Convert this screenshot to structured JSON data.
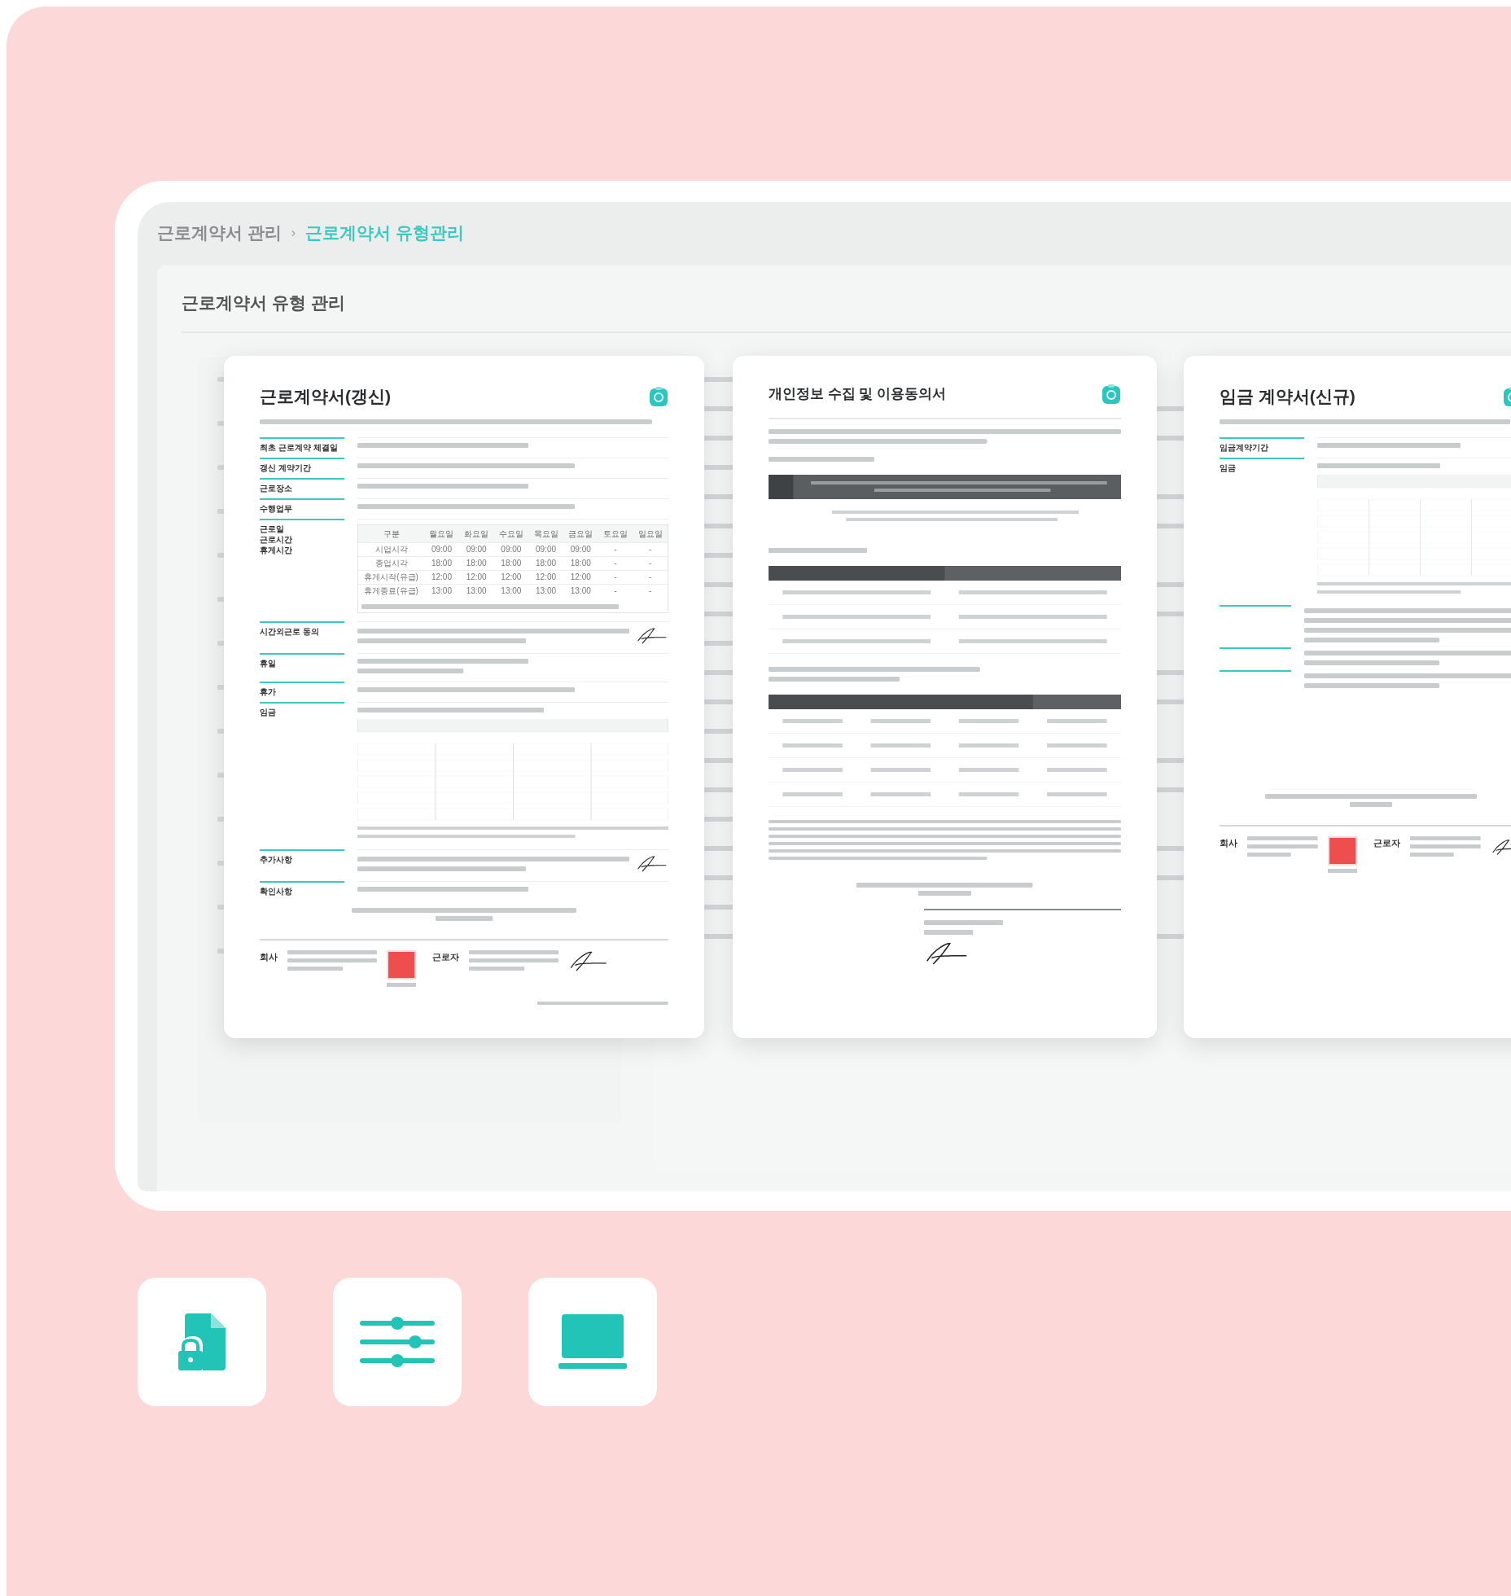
{
  "breadcrumb": {
    "separator": "›",
    "items": [
      {
        "label": "근로계약서 관리",
        "selected": false
      },
      {
        "label": "근로계약서 유형관리",
        "selected": true
      }
    ]
  },
  "page_title": "근로계약서 유형 관리",
  "documents": [
    {
      "kind": "labor",
      "title": "근로계약서(갱신)",
      "fields": [
        {
          "label": "최초 근로계약 체결일",
          "kind": "text"
        },
        {
          "label": "갱신 계약기간",
          "kind": "text"
        },
        {
          "label": "근로장소",
          "kind": "text"
        },
        {
          "label": "수행업무",
          "kind": "text"
        },
        {
          "label": "근로일\n근로시간\n휴게시간",
          "kind": "schedule"
        },
        {
          "label": "시간외근로 동의",
          "kind": "sign"
        },
        {
          "label": "휴일",
          "kind": "text"
        },
        {
          "label": "휴가",
          "kind": "text"
        },
        {
          "label": "임금",
          "kind": "wage"
        },
        {
          "label": "추가사항",
          "kind": "sign"
        },
        {
          "label": "확인사항",
          "kind": "text"
        }
      ],
      "schedule": {
        "columns": [
          "구분",
          "월요일",
          "화요일",
          "수요일",
          "목요일",
          "금요일",
          "토요일",
          "일요일"
        ],
        "rows": [
          [
            "시업시각",
            "09:00",
            "09:00",
            "09:00",
            "09:00",
            "09:00",
            "-",
            "-"
          ],
          [
            "종업시각",
            "18:00",
            "18:00",
            "18:00",
            "18:00",
            "18:00",
            "-",
            "-"
          ],
          [
            "휴게시작(유급)",
            "12:00",
            "12:00",
            "12:00",
            "12:00",
            "12:00",
            "-",
            "-"
          ],
          [
            "휴게종료(유급)",
            "13:00",
            "13:00",
            "13:00",
            "13:00",
            "13:00",
            "-",
            "-"
          ]
        ]
      },
      "parties": [
        "회사",
        "근로자"
      ]
    },
    {
      "kind": "privacy",
      "title": "개인정보 수집 및 이용동의서"
    },
    {
      "kind": "wage",
      "title": "임금 계약서(신규)",
      "fields": [
        {
          "label": "임금계약기간",
          "kind": "text"
        },
        {
          "label": "임금",
          "kind": "wage"
        }
      ],
      "parties": [
        "회사",
        "근로자"
      ]
    }
  ]
}
